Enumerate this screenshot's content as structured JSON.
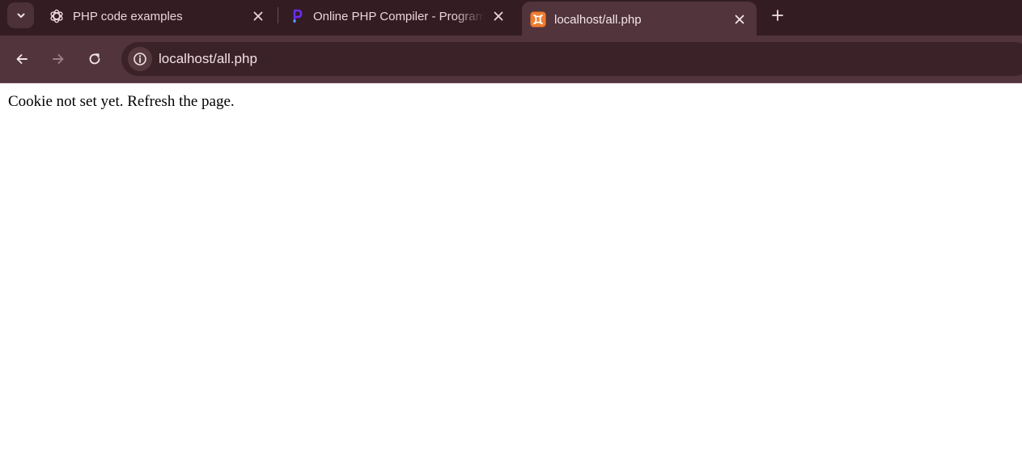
{
  "tabs": [
    {
      "title": "PHP code examples",
      "favicon": "openai-icon",
      "active": false
    },
    {
      "title": "Online PHP Compiler - Programiz",
      "favicon": "programiz-icon",
      "active": false
    },
    {
      "title": "localhost/all.php",
      "favicon": "xampp-icon",
      "active": true
    }
  ],
  "address_bar": {
    "url": "localhost/all.php"
  },
  "page": {
    "message": "Cookie not set yet. Refresh the page."
  },
  "colors": {
    "tabstrip": "#341c23",
    "toolbar": "#52343c",
    "omnibox": "#3b2229",
    "xampp": "#f07c2e",
    "programiz": "#6a2cf0"
  }
}
